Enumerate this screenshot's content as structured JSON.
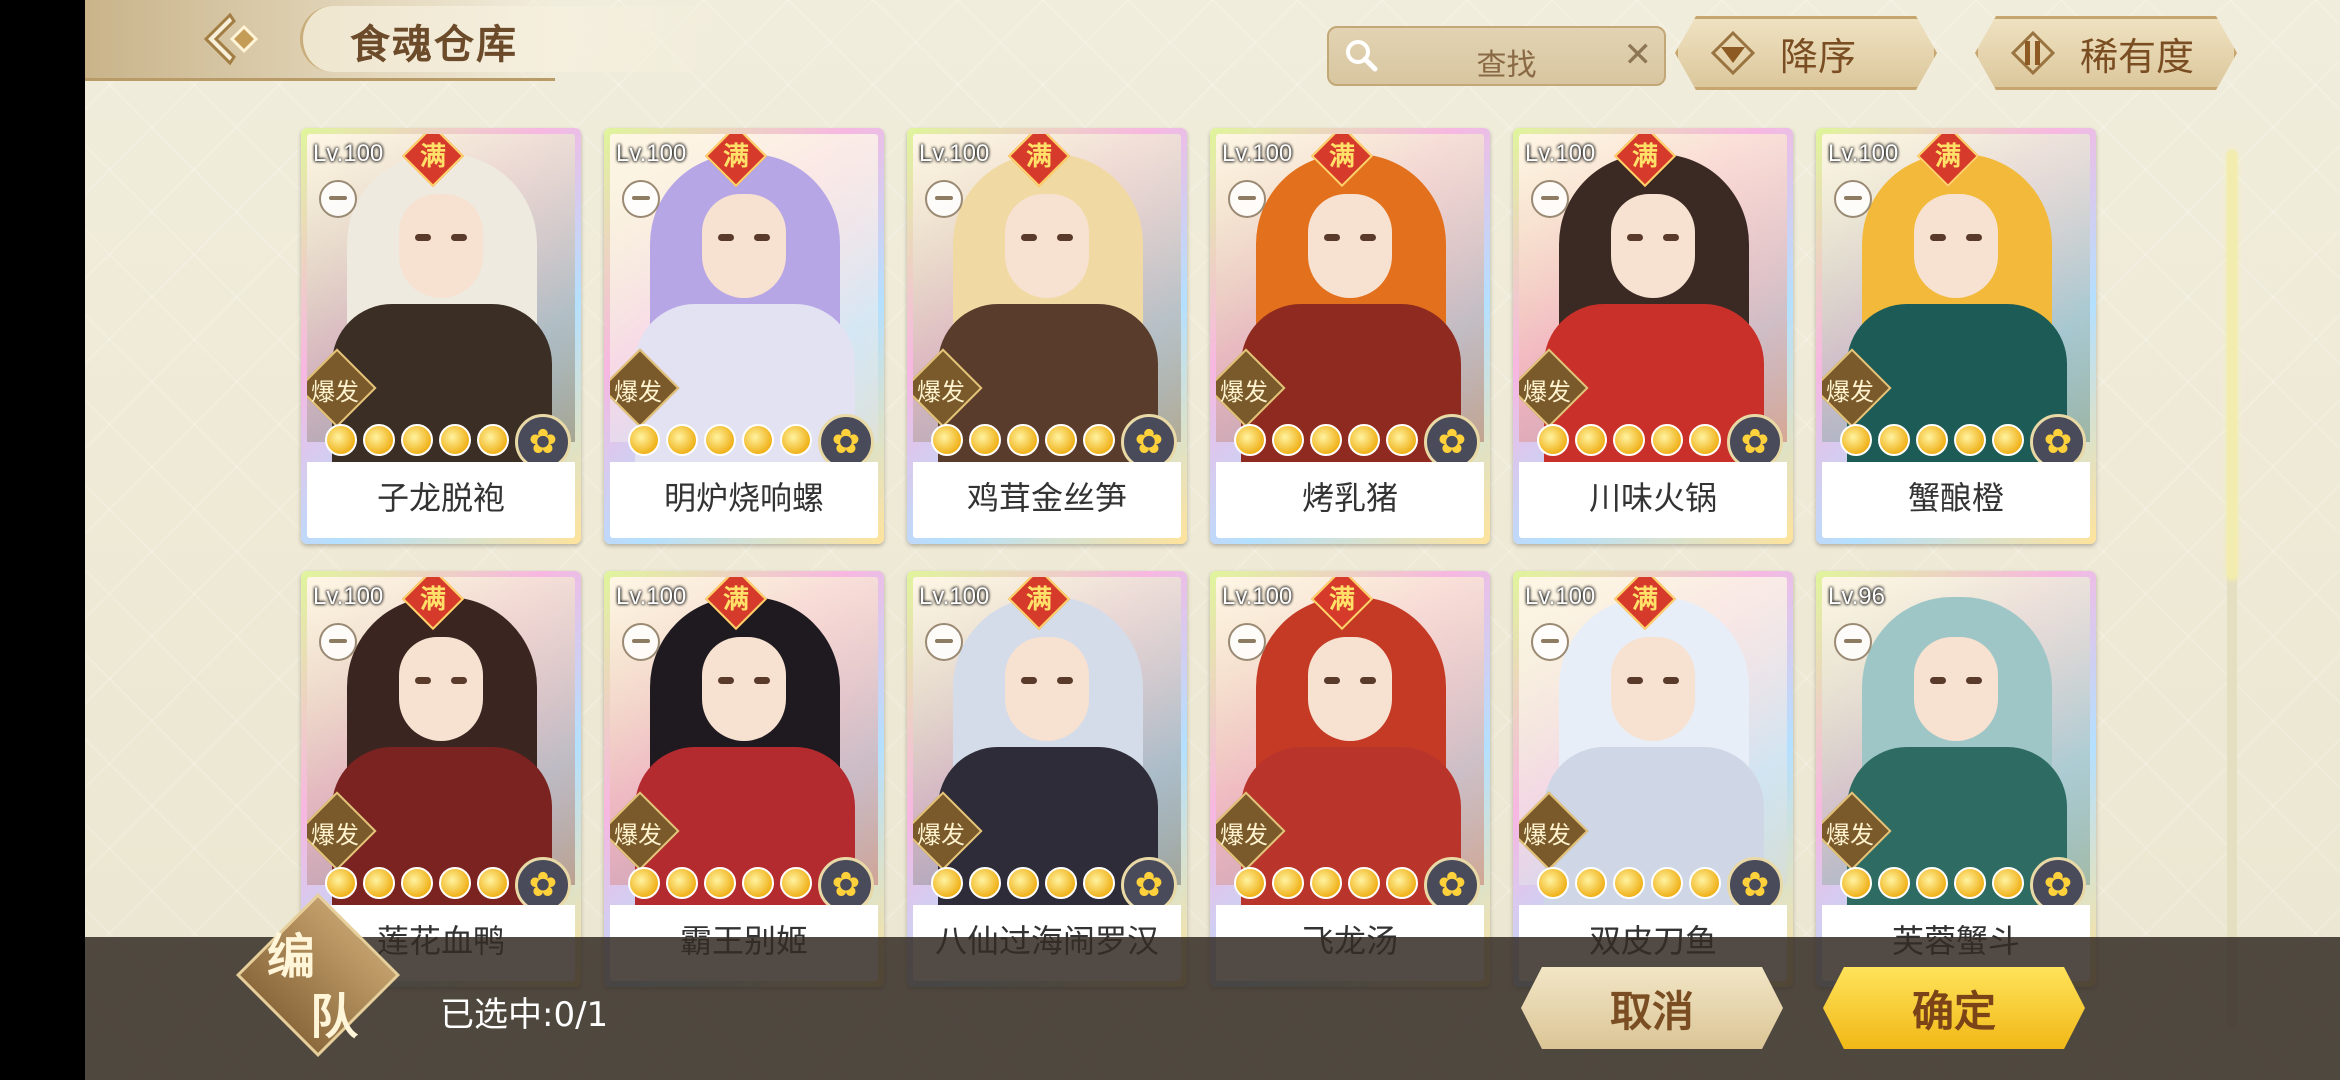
{
  "header": {
    "title": "食魂仓库",
    "search_placeholder": "查找",
    "sort_order_label": "降序",
    "sort_rarity_label": "稀有度"
  },
  "cards": [
    {
      "level": "Lv.100",
      "max": "满",
      "type": "爆发",
      "name": "子龙脱袍",
      "stars": 5,
      "hair": "#eeeae0",
      "outfit": "#3b2e24"
    },
    {
      "level": "Lv.100",
      "max": "满",
      "type": "爆发",
      "name": "明炉烧响螺",
      "stars": 5,
      "hair": "#b7a6e6",
      "outfit": "#e3e2f2"
    },
    {
      "level": "Lv.100",
      "max": "满",
      "type": "爆发",
      "name": "鸡茸金丝笋",
      "stars": 5,
      "hair": "#f0d9a2",
      "outfit": "#5a3c2c"
    },
    {
      "level": "Lv.100",
      "max": "满",
      "type": "爆发",
      "name": "烤乳猪",
      "stars": 5,
      "hair": "#e3701c",
      "outfit": "#8e2a1f"
    },
    {
      "level": "Lv.100",
      "max": "满",
      "type": "爆发",
      "name": "川味火锅",
      "stars": 5,
      "hair": "#3b2a24",
      "outfit": "#c9302a"
    },
    {
      "level": "Lv.100",
      "max": "满",
      "type": "爆发",
      "name": "蟹酿橙",
      "stars": 5,
      "hair": "#f2b93a",
      "outfit": "#1d5b57"
    },
    {
      "level": "Lv.100",
      "max": "满",
      "type": "爆发",
      "name": "莲花血鸭",
      "stars": 5,
      "hair": "#3a2520",
      "outfit": "#7a2320"
    },
    {
      "level": "Lv.100",
      "max": "满",
      "type": "爆发",
      "name": "霸王别姬",
      "stars": 5,
      "hair": "#1f1a20",
      "outfit": "#b42b2f"
    },
    {
      "level": "Lv.100",
      "max": "满",
      "type": "爆发",
      "name": "八仙过海闹罗汉",
      "stars": 5,
      "hair": "#d4dbe9",
      "outfit": "#2d2c38"
    },
    {
      "level": "Lv.100",
      "max": "满",
      "type": "爆发",
      "name": "飞龙汤",
      "stars": 5,
      "hair": "#c53a25",
      "outfit": "#b9352b"
    },
    {
      "level": "Lv.100",
      "max": "满",
      "type": "爆发",
      "name": "双皮刀鱼",
      "stars": 5,
      "hair": "#e8eef7",
      "outfit": "#cfd7e6"
    },
    {
      "level": "Lv.96",
      "max": "",
      "type": "爆发",
      "name": "芙蓉蟹斗",
      "stars": 5,
      "hair": "#9fc6c6",
      "outfit": "#2e6b62"
    }
  ],
  "footer": {
    "team_label_1": "编",
    "team_label_2": "队",
    "selected_text": "已选中:0/1",
    "cancel_label": "取消",
    "confirm_label": "确定"
  }
}
